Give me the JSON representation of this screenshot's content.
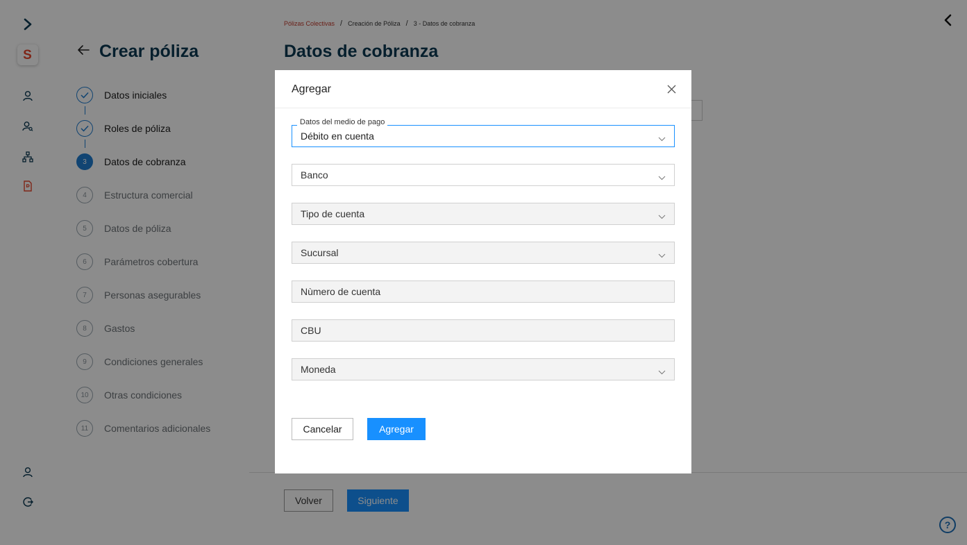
{
  "rail": {
    "logo_letter": "S",
    "brand_color": "#e8462c"
  },
  "steps_panel": {
    "title": "Crear póliza",
    "steps": [
      {
        "num": "",
        "label": "Datos iniciales",
        "state": "done"
      },
      {
        "num": "",
        "label": "Roles de póliza",
        "state": "done"
      },
      {
        "num": "3",
        "label": "Datos de cobranza",
        "state": "active"
      },
      {
        "num": "4",
        "label": "Estructura comercial",
        "state": "pending"
      },
      {
        "num": "5",
        "label": "Datos de póliza",
        "state": "pending"
      },
      {
        "num": "6",
        "label": "Parámetros cobertura",
        "state": "pending"
      },
      {
        "num": "7",
        "label": "Personas asegurables",
        "state": "pending"
      },
      {
        "num": "8",
        "label": "Gastos",
        "state": "pending"
      },
      {
        "num": "9",
        "label": "Condiciones generales",
        "state": "pending"
      },
      {
        "num": "10",
        "label": "Otras condiciones",
        "state": "pending"
      },
      {
        "num": "11",
        "label": "Comentarios adicionales",
        "state": "pending"
      }
    ]
  },
  "breadcrumb": {
    "items": [
      "Pólizas Colectivas",
      "Creación de Póliza",
      "3 - Datos de cobranza"
    ],
    "separator": "/"
  },
  "main": {
    "title": "Datos de cobranza",
    "back_label": "Volver",
    "next_label": "Siguiente",
    "help_label": "?"
  },
  "modal": {
    "title": "Agregar",
    "payment_label": "Datos del medio de pago",
    "payment_value": "Débito en cuenta",
    "bank_placeholder": "Banco",
    "account_type_placeholder": "Tipo de cuenta",
    "branch_placeholder": "Sucursal",
    "account_number_placeholder": "Nùmero de cuenta",
    "cbu_placeholder": "CBU",
    "currency_placeholder": "Moneda",
    "cancel_label": "Cancelar",
    "add_label": "Agregar"
  },
  "colors": {
    "primary": "#1890ff",
    "step_active": "#1f7dd0",
    "heading": "#0b3a53"
  }
}
